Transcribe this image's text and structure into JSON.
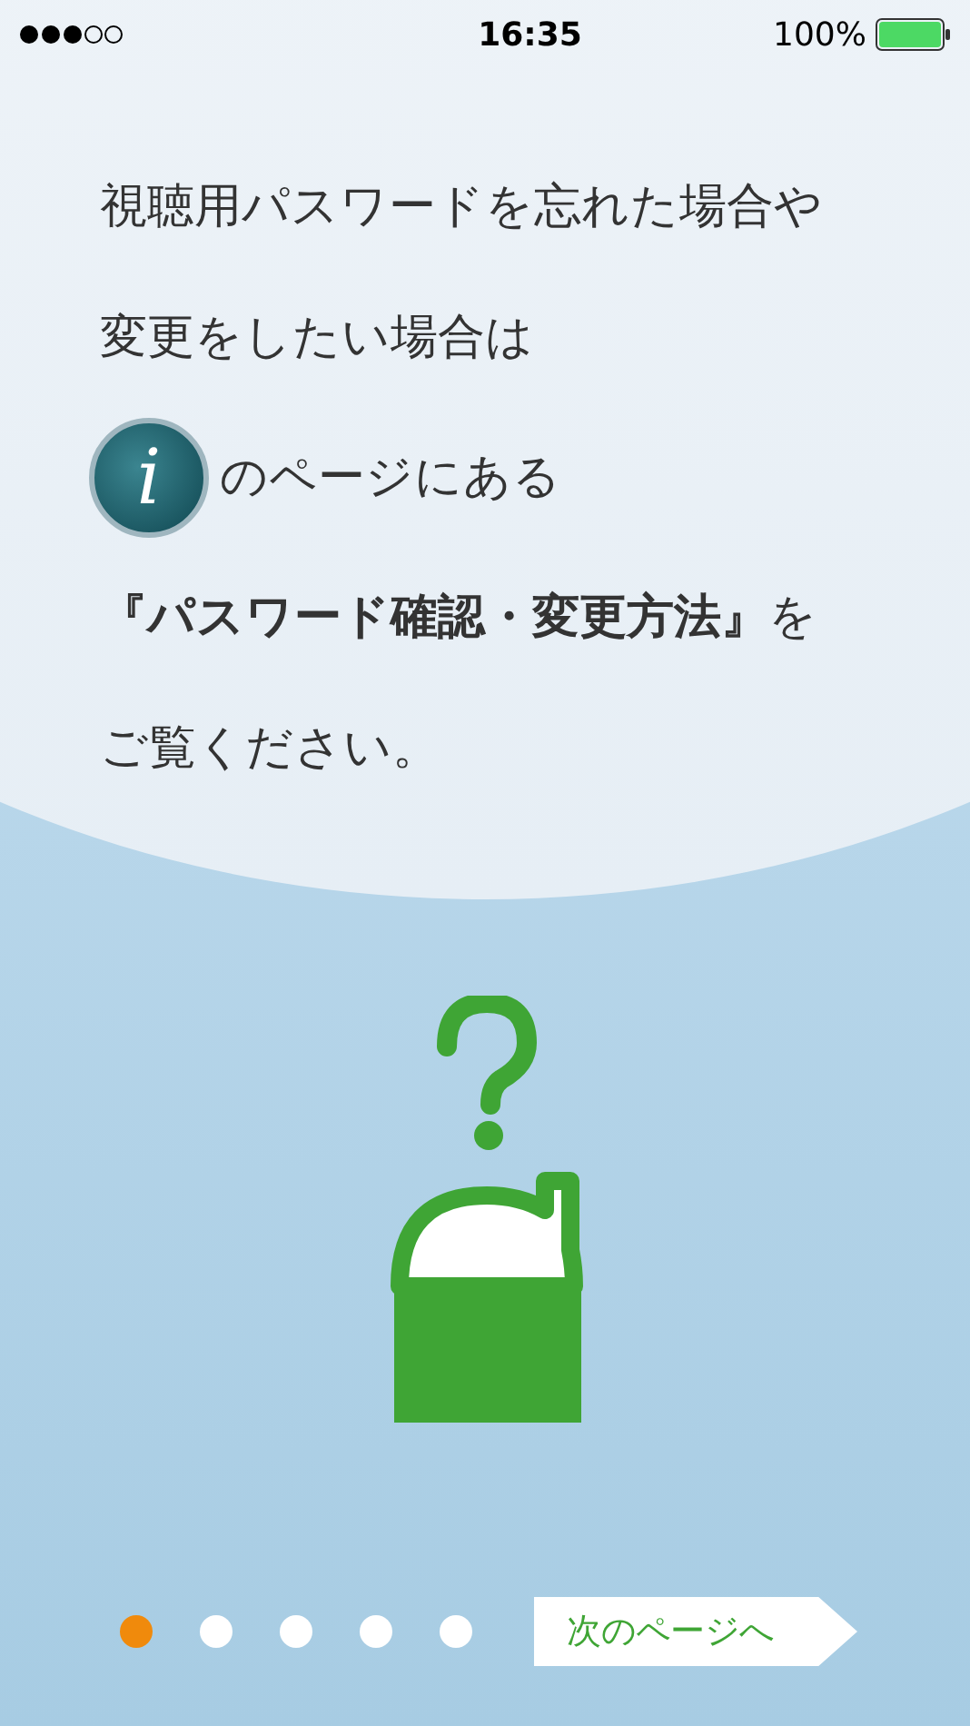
{
  "status_bar": {
    "time": "16:35",
    "battery": "100%"
  },
  "message": {
    "lines": [
      "視聴用パスワードを忘れた場合や",
      "変更をしたい場合は"
    ],
    "info_line": {
      "glyph": "i",
      "text": "のページにある"
    },
    "lines_after": [
      "**『パスワード確認・変更方法』**を",
      "ご覧ください。"
    ]
  },
  "pager": {
    "dots": [
      {
        "selected": true
      },
      {
        "selected": false
      },
      {
        "selected": false
      },
      {
        "selected": false
      },
      {
        "selected": false
      }
    ]
  },
  "next_button": {
    "label": "次のページへ"
  }
}
